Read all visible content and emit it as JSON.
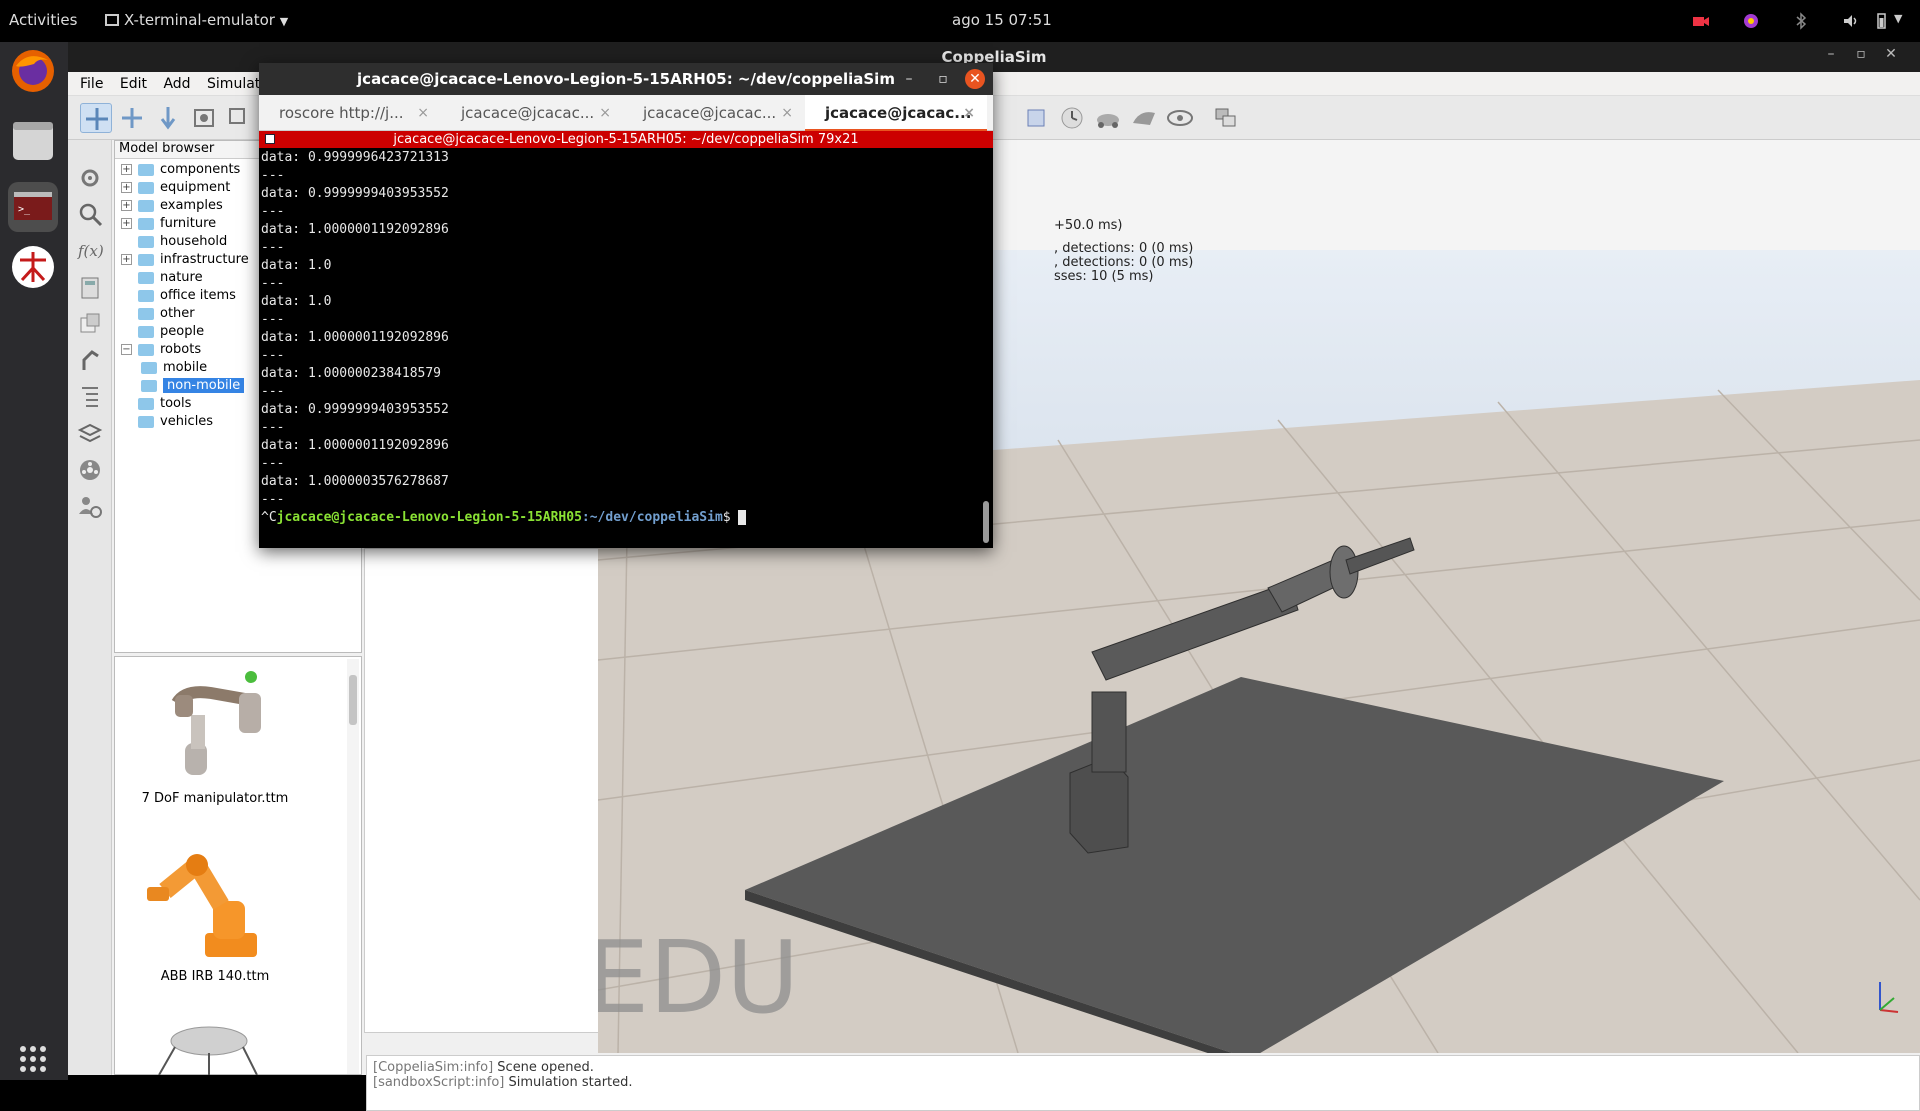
{
  "topbar": {
    "activities": "Activities",
    "app_menu": "X-terminal-emulator",
    "clock": "ago 15  07:51"
  },
  "dock": {
    "icons": [
      "firefox-icon",
      "files-icon",
      "terminal-icon",
      "coppeliasim-icon",
      "show-apps-icon"
    ]
  },
  "sim_window": {
    "title": "CoppeliaSim",
    "menu": [
      "File",
      "Edit",
      "Add",
      "Simulation"
    ],
    "model_browser": {
      "header": "Model browser",
      "items": [
        {
          "label": "components",
          "expandable": true,
          "level": 0
        },
        {
          "label": "equipment",
          "expandable": true,
          "level": 0
        },
        {
          "label": "examples",
          "expandable": true,
          "level": 0
        },
        {
          "label": "furniture",
          "expandable": true,
          "level": 0
        },
        {
          "label": "household",
          "expandable": false,
          "level": 0
        },
        {
          "label": "infrastructure",
          "expandable": true,
          "level": 0
        },
        {
          "label": "nature",
          "expandable": false,
          "level": 0
        },
        {
          "label": "office items",
          "expandable": false,
          "level": 0
        },
        {
          "label": "other",
          "expandable": false,
          "level": 0
        },
        {
          "label": "people",
          "expandable": false,
          "level": 0
        },
        {
          "label": "robots",
          "expandable": true,
          "expanded": true,
          "level": 0
        },
        {
          "label": "mobile",
          "expandable": false,
          "level": 1
        },
        {
          "label": "non-mobile",
          "expandable": false,
          "level": 1,
          "selected": true
        },
        {
          "label": "tools",
          "expandable": false,
          "level": 0
        },
        {
          "label": "vehicles",
          "expandable": false,
          "level": 0
        }
      ]
    },
    "thumbnails": [
      "7 DoF manipulator.ttm",
      "ABB IRB 140.ttm"
    ],
    "viewport": {
      "info_lines": [
        "+50.0 ms)",
        ", detections: 0 (0 ms)",
        ", detections: 0 (0 ms)",
        "sses: 10 (5 ms)"
      ],
      "watermark": "EDU"
    },
    "console": [
      {
        "tag": "[CoppeliaSim:info]",
        "text": " Scene opened."
      },
      {
        "tag": "[sandboxScript:info]",
        "text": " Simulation started."
      }
    ]
  },
  "terminal": {
    "title": "jcacace@jcacace-Lenovo-Legion-5-15ARH05: ~/dev/coppeliaSim",
    "tabs": [
      "roscore http://j...",
      "jcacace@jcacac...",
      "jcacace@jcacac...",
      "jcacace@jcacac..."
    ],
    "subtitle": "jcacace@jcacace-Lenovo-Legion-5-15ARH05: ~/dev/coppeliaSim 79x21",
    "lines": [
      "data: 0.9999996423721313",
      "---",
      "data: 0.9999999403953552",
      "---",
      "data: 1.0000001192092896",
      "---",
      "data: 1.0",
      "---",
      "data: 1.0",
      "---",
      "data: 1.0000001192092896",
      "---",
      "data: 1.000000238418579",
      "---",
      "data: 0.9999999403953552",
      "---",
      "data: 1.0000001192092896",
      "---",
      "data: 1.0000003576278687",
      "---"
    ],
    "prompt_prefix": "^C",
    "prompt_user": "jcacace@jcacace-Lenovo-Legion-5-15ARH05",
    "prompt_path": ":~/dev/coppeliaSim",
    "prompt_suffix": "$ "
  }
}
